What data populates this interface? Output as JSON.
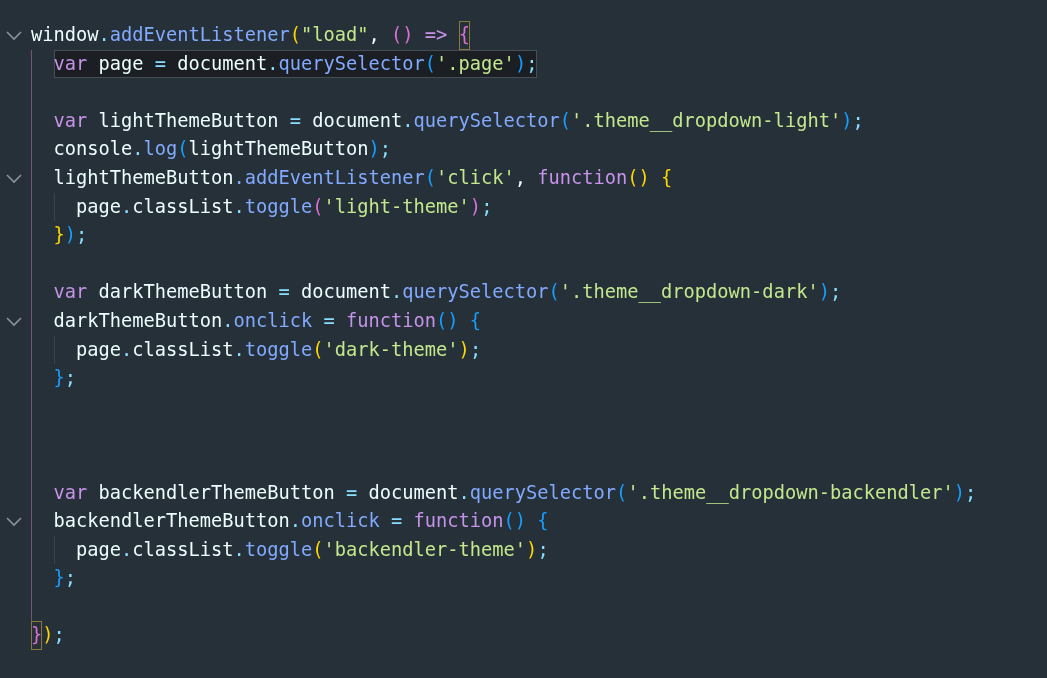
{
  "editor": {
    "lines": [
      {
        "expanded": true,
        "tokens": [
          {
            "kind": "id",
            "text": "window"
          },
          {
            "kind": "punc",
            "text": "."
          },
          {
            "kind": "fn",
            "text": "addEventListener"
          },
          {
            "kind": "br1",
            "text": "("
          },
          {
            "kind": "str",
            "text": "\"load\""
          },
          {
            "kind": "id",
            "text": ", "
          },
          {
            "kind": "br2",
            "text": "()"
          },
          {
            "kind": "op",
            "text": " => "
          },
          {
            "kind": "br2",
            "text": "{",
            "matched": true
          }
        ],
        "children": [
          {
            "current": true,
            "tokens": [
              {
                "kind": "kw",
                "text": "var"
              },
              {
                "kind": "id",
                "text": " page "
              },
              {
                "kind": "punc",
                "text": "="
              },
              {
                "kind": "id",
                "text": " document"
              },
              {
                "kind": "punc",
                "text": "."
              },
              {
                "kind": "fn",
                "text": "querySelector"
              },
              {
                "kind": "br3",
                "text": "("
              },
              {
                "kind": "str",
                "text": "'.page'"
              },
              {
                "kind": "br3",
                "text": ")"
              },
              {
                "kind": "punc",
                "text": ";"
              }
            ]
          },
          {
            "current": false
          },
          {
            "current": false,
            "tokens": [
              {
                "kind": "kw",
                "text": "var"
              },
              {
                "kind": "id",
                "text": " lightThemeButton "
              },
              {
                "kind": "punc",
                "text": "="
              },
              {
                "kind": "id",
                "text": " document"
              },
              {
                "kind": "punc",
                "text": "."
              },
              {
                "kind": "fn",
                "text": "querySelector"
              },
              {
                "kind": "br3",
                "text": "("
              },
              {
                "kind": "str",
                "text": "'.theme__dropdown-light'"
              },
              {
                "kind": "br3",
                "text": ")"
              },
              {
                "kind": "punc",
                "text": ";"
              }
            ]
          },
          {
            "current": false,
            "tokens": [
              {
                "kind": "id",
                "text": "console"
              },
              {
                "kind": "punc",
                "text": "."
              },
              {
                "kind": "fn",
                "text": "log"
              },
              {
                "kind": "br3",
                "text": "("
              },
              {
                "kind": "id",
                "text": "lightThemeButton"
              },
              {
                "kind": "br3",
                "text": ")"
              },
              {
                "kind": "punc",
                "text": ";"
              }
            ]
          },
          {
            "current": false,
            "expanded": true,
            "tokens": [
              {
                "kind": "id",
                "text": "lightThemeButton"
              },
              {
                "kind": "fn",
                "text": ".addEventListener"
              },
              {
                "kind": "br3",
                "text": "("
              },
              {
                "kind": "str",
                "text": "'click'"
              },
              {
                "kind": "id",
                "text": ", "
              },
              {
                "kind": "kw",
                "text": "function"
              },
              {
                "kind": "br1",
                "text": "()"
              },
              {
                "kind": "br1",
                "text": " {"
              }
            ],
            "children": [
              {
                "current": false,
                "tokens": [
                  {
                    "kind": "id",
                    "text": "page"
                  },
                  {
                    "kind": "punc",
                    "text": "."
                  },
                  {
                    "kind": "id",
                    "text": "classList"
                  },
                  {
                    "kind": "punc",
                    "text": "."
                  },
                  {
                    "kind": "fn",
                    "text": "toggle"
                  },
                  {
                    "kind": "br2",
                    "text": "("
                  },
                  {
                    "kind": "str",
                    "text": "'light-theme'"
                  },
                  {
                    "kind": "br2",
                    "text": ")"
                  },
                  {
                    "kind": "punc",
                    "text": ";"
                  }
                ]
              }
            ]
          },
          {
            "current": false,
            "tokens": [
              {
                "kind": "br1",
                "text": "}"
              },
              {
                "kind": "br3",
                "text": ")"
              },
              {
                "kind": "punc",
                "text": ";"
              }
            ]
          },
          {
            "current": false
          },
          {
            "current": false,
            "tokens": [
              {
                "kind": "kw",
                "text": "var"
              },
              {
                "kind": "id",
                "text": " darkThemeButton "
              },
              {
                "kind": "punc",
                "text": "="
              },
              {
                "kind": "id",
                "text": " document"
              },
              {
                "kind": "punc",
                "text": "."
              },
              {
                "kind": "fn",
                "text": "querySelector"
              },
              {
                "kind": "br3",
                "text": "("
              },
              {
                "kind": "str",
                "text": "'.theme__dropdown-dark'"
              },
              {
                "kind": "br3",
                "text": ")"
              },
              {
                "kind": "punc",
                "text": ";"
              }
            ]
          },
          {
            "current": false,
            "expanded": true,
            "tokens": [
              {
                "kind": "id",
                "text": "darkThemeButton"
              },
              {
                "kind": "punc",
                "text": "."
              },
              {
                "kind": "fn",
                "text": "onclick"
              },
              {
                "kind": "punc",
                "text": " = "
              },
              {
                "kind": "kw",
                "text": "function"
              },
              {
                "kind": "br3",
                "text": "()"
              },
              {
                "kind": "br3",
                "text": " {"
              }
            ],
            "children": [
              {
                "current": false,
                "tokens": [
                  {
                    "kind": "id",
                    "text": "page"
                  },
                  {
                    "kind": "punc",
                    "text": "."
                  },
                  {
                    "kind": "id",
                    "text": "classList"
                  },
                  {
                    "kind": "punc",
                    "text": "."
                  },
                  {
                    "kind": "fn",
                    "text": "toggle"
                  },
                  {
                    "kind": "br1",
                    "text": "("
                  },
                  {
                    "kind": "str",
                    "text": "'dark-theme'"
                  },
                  {
                    "kind": "br1",
                    "text": ")"
                  },
                  {
                    "kind": "punc",
                    "text": ";"
                  }
                ]
              }
            ]
          },
          {
            "current": false,
            "tokens": [
              {
                "kind": "br3",
                "text": "}"
              },
              {
                "kind": "punc",
                "text": ";"
              }
            ]
          },
          {
            "current": false
          },
          {
            "current": false
          },
          {
            "current": false
          },
          {
            "current": false,
            "tokens": [
              {
                "kind": "kw",
                "text": "var"
              },
              {
                "kind": "id",
                "text": " backendlerThemeButton "
              },
              {
                "kind": "punc",
                "text": "="
              },
              {
                "kind": "id",
                "text": " document"
              },
              {
                "kind": "punc",
                "text": "."
              },
              {
                "kind": "fn",
                "text": "querySelector"
              },
              {
                "kind": "br3",
                "text": "("
              },
              {
                "kind": "str",
                "text": "'.theme__dropdown-backendler'"
              },
              {
                "kind": "br3",
                "text": ")"
              },
              {
                "kind": "punc",
                "text": ";"
              }
            ]
          },
          {
            "current": false,
            "expanded": true,
            "tokens": [
              {
                "kind": "id",
                "text": "backendlerThemeButton"
              },
              {
                "kind": "punc",
                "text": "."
              },
              {
                "kind": "fn",
                "text": "onclick"
              },
              {
                "kind": "punc",
                "text": " = "
              },
              {
                "kind": "kw",
                "text": "function"
              },
              {
                "kind": "br3",
                "text": "()"
              },
              {
                "kind": "br3",
                "text": " {"
              }
            ],
            "children": [
              {
                "current": false,
                "tokens": [
                  {
                    "kind": "id",
                    "text": "page"
                  },
                  {
                    "kind": "punc",
                    "text": "."
                  },
                  {
                    "kind": "id",
                    "text": "classList"
                  },
                  {
                    "kind": "punc",
                    "text": "."
                  },
                  {
                    "kind": "fn",
                    "text": "toggle"
                  },
                  {
                    "kind": "br1",
                    "text": "("
                  },
                  {
                    "kind": "str",
                    "text": "'backendler-theme'"
                  },
                  {
                    "kind": "br1",
                    "text": ")"
                  },
                  {
                    "kind": "punc",
                    "text": ";"
                  }
                ]
              }
            ]
          },
          {
            "current": false,
            "tokens": [
              {
                "kind": "br3",
                "text": "}"
              },
              {
                "kind": "punc",
                "text": ";"
              }
            ]
          },
          {
            "current": false
          }
        ]
      },
      {
        "current": false,
        "tokens": [
          {
            "kind": "br2",
            "text": "}",
            "matched": true
          },
          {
            "kind": "br1",
            "text": ")"
          },
          {
            "kind": "punc",
            "text": ";"
          }
        ]
      }
    ]
  }
}
